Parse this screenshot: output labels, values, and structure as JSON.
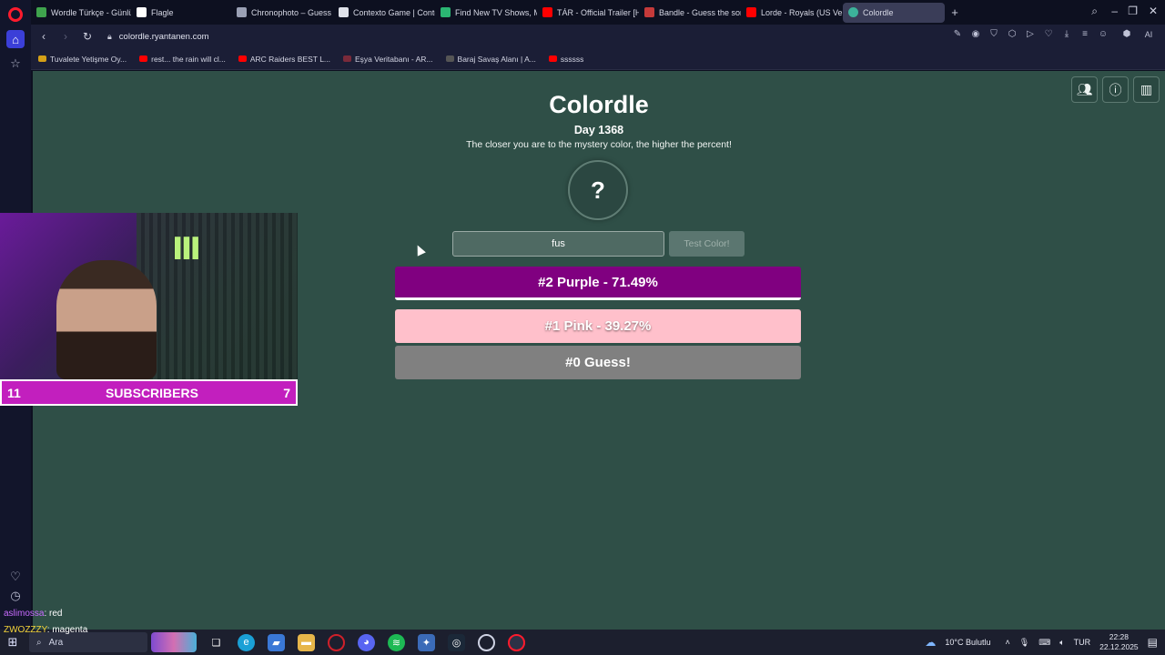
{
  "browser": {
    "tabs": [
      {
        "label": "Wordle Türkçe - Günlük K",
        "color": "#3fa34d"
      },
      {
        "label": "Flagle",
        "color": "#ffffff"
      },
      {
        "label": "Chronophoto – Guess the",
        "color": "#9aa0b4"
      },
      {
        "label": "Contexto Game | Contexto",
        "color": "#dfe2ea"
      },
      {
        "label": "Find New TV Shows, Movi",
        "color": "#2bb673"
      },
      {
        "label": "TÁR - Official Trailer [HD]",
        "color": "#ff0000"
      },
      {
        "label": "Bandle - Guess the song, d",
        "color": "#c53a3a"
      },
      {
        "label": "Lorde - Royals (US Version",
        "color": "#ff0000"
      },
      {
        "label": "Colordle",
        "color": "#3cb29a",
        "active": true
      }
    ],
    "new_tab": "+",
    "url": "colordle.ryantanen.com",
    "bookmarks": [
      {
        "label": "Tuvalete Yetişme Oy...",
        "color": "#d4a017"
      },
      {
        "label": "rest... the rain will cl...",
        "color": "#ff0000"
      },
      {
        "label": "ARC Raiders BEST L...",
        "color": "#ff0000"
      },
      {
        "label": "Eşya Veritabanı - AR...",
        "color": "#7a2a3a"
      },
      {
        "label": "Baraj Savaş Alanı | A...",
        "color": "#555555"
      },
      {
        "label": "ssssss",
        "color": "#ff0000"
      }
    ]
  },
  "game": {
    "title": "Colordle",
    "day": "Day 1368",
    "subtitle": "The closer you are to the mystery color, the higher the percent!",
    "mystery_symbol": "?",
    "input_value": "fus",
    "test_button": "Test Color!",
    "guesses": [
      {
        "label": "#2 Purple - 71.49%",
        "color": "#800080"
      },
      {
        "label": "#1 Pink - 39.27%",
        "color": "#ffc0cb"
      },
      {
        "label": "#0 Guess!",
        "color": "#808080"
      }
    ]
  },
  "stream": {
    "bar_left": "11",
    "bar_center": "SUBSCRIBERS",
    "bar_right": "7",
    "chat": [
      {
        "user": "aslimossa",
        "message": ": red"
      },
      {
        "user": "ZWOZZZY",
        "message": ": magenta"
      }
    ]
  },
  "taskbar": {
    "search": "Ara",
    "weather": "10°C  Bulutlu",
    "lang": "TUR",
    "time": "22:28",
    "date": "22.12.2025"
  }
}
